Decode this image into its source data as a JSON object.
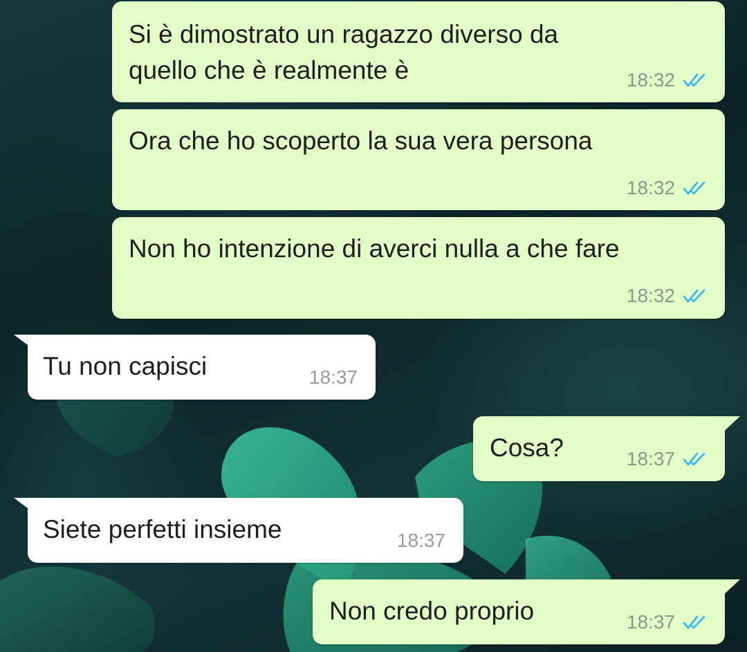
{
  "colors": {
    "outgoing_bubble": "#e2fdc8",
    "incoming_bubble": "#ffffff",
    "read_ticks": "#34b7f1",
    "timestamp": "#8a9a8a"
  },
  "icons": {
    "read_receipt": "double-check-icon"
  },
  "messages": [
    {
      "direction": "outgoing",
      "text": "Si è dimostrato un ragazzo diverso da\nquello che è realmente è",
      "time": "18:32",
      "status": "read"
    },
    {
      "direction": "outgoing",
      "text": "Ora che ho scoperto la sua vera persona",
      "time": "18:32",
      "status": "read"
    },
    {
      "direction": "outgoing",
      "text": "Non ho intenzione di averci nulla a che fare",
      "time": "18:32",
      "status": "read"
    },
    {
      "direction": "incoming",
      "text": "Tu non capisci",
      "time": "18:37"
    },
    {
      "direction": "outgoing",
      "text": "Cosa?",
      "time": "18:37",
      "status": "read"
    },
    {
      "direction": "incoming",
      "text": "Siete perfetti insieme",
      "time": "18:37"
    },
    {
      "direction": "outgoing",
      "text": "Non credo proprio",
      "time": "18:37",
      "status": "read"
    }
  ]
}
